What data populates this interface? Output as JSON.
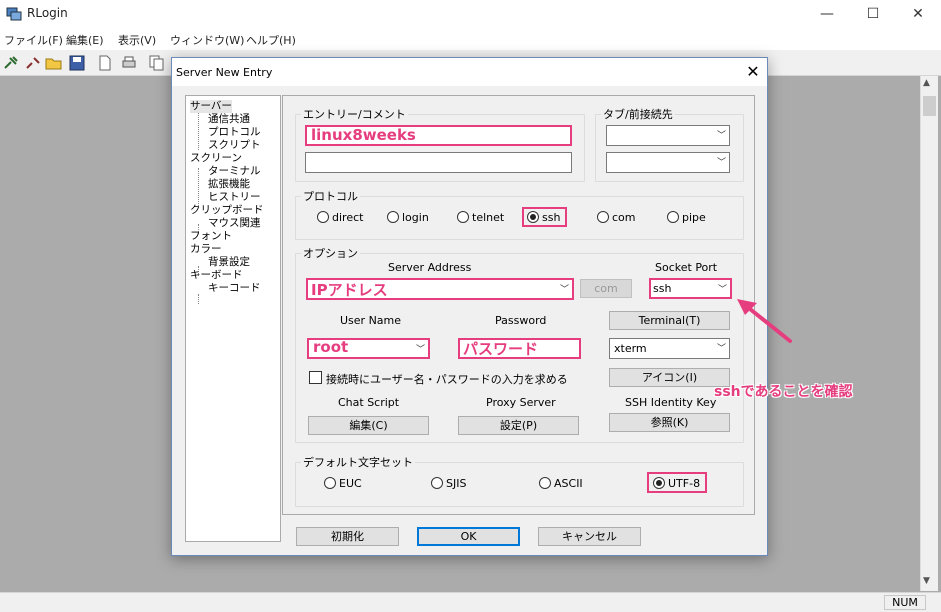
{
  "app": {
    "title": "RLogin",
    "minimize": "—",
    "maximize": "☐",
    "close": "✕"
  },
  "menu": [
    {
      "label": "ファイル(F)"
    },
    {
      "label": "編集(E)"
    },
    {
      "label": "表示(V)"
    },
    {
      "label": "ウィンドウ(W)"
    },
    {
      "label": "ヘルプ(H)"
    }
  ],
  "status": {
    "num": "NUM"
  },
  "dialog": {
    "title": "Server New Entry",
    "close": "✕",
    "tree": [
      {
        "label": "サーバー",
        "level": 0
      },
      {
        "label": "通信共通",
        "level": 1
      },
      {
        "label": "プロトコル",
        "level": 1
      },
      {
        "label": "スクリプト",
        "level": 1
      },
      {
        "label": "スクリーン",
        "level": 0
      },
      {
        "label": "ターミナル",
        "level": 1
      },
      {
        "label": "拡張機能",
        "level": 1
      },
      {
        "label": "ヒストリー",
        "level": 1
      },
      {
        "label": "クリップボード",
        "level": 0
      },
      {
        "label": "マウス関連",
        "level": 1
      },
      {
        "label": "フォント",
        "level": 0
      },
      {
        "label": "カラー",
        "level": 0
      },
      {
        "label": "背景設定",
        "level": 1
      },
      {
        "label": "キーボード",
        "level": 0
      },
      {
        "label": "キーコード",
        "level": 1
      }
    ],
    "entry": {
      "label": "エントリー/コメント",
      "name": "linux8weeks",
      "comment": ""
    },
    "tab": {
      "label": "タブ/前接続先",
      "value1": "",
      "value2": ""
    },
    "protocol": {
      "label": "プロトコル",
      "options": [
        "direct",
        "login",
        "telnet",
        "ssh",
        "com",
        "pipe"
      ],
      "selected": "ssh"
    },
    "option": {
      "label": "オプション",
      "server_address_label": "Server Address",
      "server_address": "IPアドレス",
      "com_button": "com",
      "socket_port_label": "Socket Port",
      "socket_port": "ssh",
      "user_name_label": "User Name",
      "user_name": "root",
      "password_label": "Password",
      "password": "パスワード",
      "terminal_button": "Terminal(T)",
      "terminal_type": "xterm",
      "icon_button": "アイコン(I)",
      "checkbox_label": "接続時にユーザー名・パスワードの入力を求める",
      "chat_script_label": "Chat Script",
      "chat_script_button": "編集(C)",
      "proxy_label": "Proxy Server",
      "proxy_button": "設定(P)",
      "ssh_key_label": "SSH Identity Key",
      "ssh_key_button": "参照(K)"
    },
    "charset": {
      "label": "デフォルト文字セット",
      "options": [
        "EUC",
        "SJIS",
        "ASCII",
        "UTF-8"
      ],
      "selected": "UTF-8"
    },
    "buttons": {
      "init": "初期化",
      "ok": "OK",
      "cancel": "キャンセル"
    }
  },
  "annotation": {
    "text": "sshであることを確認",
    "color": "#e63d7f"
  }
}
